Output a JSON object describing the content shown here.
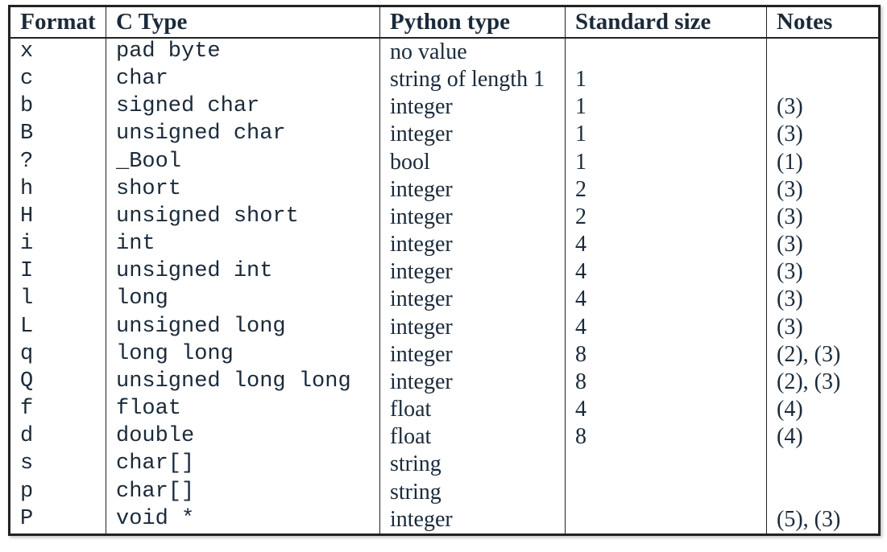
{
  "chart_data": {
    "type": "table",
    "title": "",
    "columns": [
      "Format",
      "C Type",
      "Python type",
      "Standard size",
      "Notes"
    ],
    "rows": [
      [
        "x",
        "pad byte",
        "no value",
        "",
        ""
      ],
      [
        "c",
        "char",
        "string of length 1",
        "1",
        ""
      ],
      [
        "b",
        "signed char",
        "integer",
        "1",
        "(3)"
      ],
      [
        "B",
        "unsigned char",
        "integer",
        "1",
        "(3)"
      ],
      [
        "?",
        "_Bool",
        "bool",
        "1",
        "(1)"
      ],
      [
        "h",
        "short",
        "integer",
        "2",
        "(3)"
      ],
      [
        "H",
        "unsigned short",
        "integer",
        "2",
        "(3)"
      ],
      [
        "i",
        "int",
        "integer",
        "4",
        "(3)"
      ],
      [
        "I",
        "unsigned int",
        "integer",
        "4",
        "(3)"
      ],
      [
        "l",
        "long",
        "integer",
        "4",
        "(3)"
      ],
      [
        "L",
        "unsigned long",
        "integer",
        "4",
        "(3)"
      ],
      [
        "q",
        "long long",
        "integer",
        "8",
        "(2), (3)"
      ],
      [
        "Q",
        "unsigned long long",
        "integer",
        "8",
        "(2), (3)"
      ],
      [
        "f",
        "float",
        "float",
        "4",
        "(4)"
      ],
      [
        "d",
        "double",
        "float",
        "8",
        "(4)"
      ],
      [
        "s",
        "char[]",
        "string",
        "",
        ""
      ],
      [
        "p",
        "char[]",
        "string",
        "",
        ""
      ],
      [
        "P",
        "void *",
        "integer",
        "",
        "(5), (3)"
      ]
    ]
  },
  "headers": {
    "format": "Format",
    "ctype": "C Type",
    "pytype": "Python type",
    "size": "Standard size",
    "notes": "Notes"
  }
}
